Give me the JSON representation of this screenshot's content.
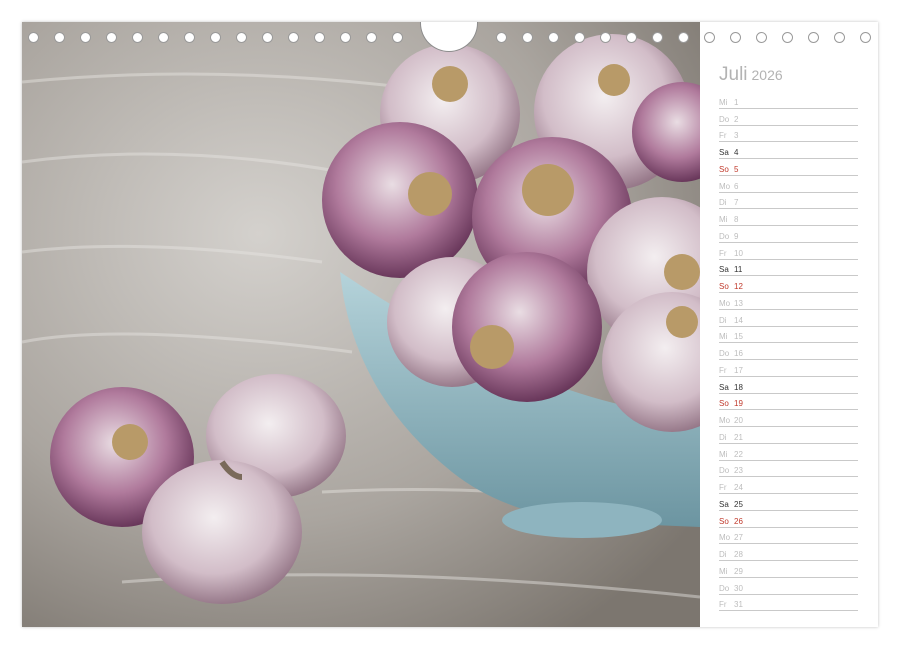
{
  "calendar": {
    "month": "Juli",
    "year": "2026",
    "days": [
      {
        "wd": "Mi",
        "d": "1",
        "type": "weekday"
      },
      {
        "wd": "Do",
        "d": "2",
        "type": "weekday"
      },
      {
        "wd": "Fr",
        "d": "3",
        "type": "weekday"
      },
      {
        "wd": "Sa",
        "d": "4",
        "type": "sat"
      },
      {
        "wd": "So",
        "d": "5",
        "type": "sun"
      },
      {
        "wd": "Mo",
        "d": "6",
        "type": "weekday"
      },
      {
        "wd": "Di",
        "d": "7",
        "type": "weekday"
      },
      {
        "wd": "Mi",
        "d": "8",
        "type": "weekday"
      },
      {
        "wd": "Do",
        "d": "9",
        "type": "weekday"
      },
      {
        "wd": "Fr",
        "d": "10",
        "type": "weekday"
      },
      {
        "wd": "Sa",
        "d": "11",
        "type": "sat"
      },
      {
        "wd": "So",
        "d": "12",
        "type": "sun"
      },
      {
        "wd": "Mo",
        "d": "13",
        "type": "weekday"
      },
      {
        "wd": "Di",
        "d": "14",
        "type": "weekday"
      },
      {
        "wd": "Mi",
        "d": "15",
        "type": "weekday"
      },
      {
        "wd": "Do",
        "d": "16",
        "type": "weekday"
      },
      {
        "wd": "Fr",
        "d": "17",
        "type": "weekday"
      },
      {
        "wd": "Sa",
        "d": "18",
        "type": "sat"
      },
      {
        "wd": "So",
        "d": "19",
        "type": "sun"
      },
      {
        "wd": "Mo",
        "d": "20",
        "type": "weekday"
      },
      {
        "wd": "Di",
        "d": "21",
        "type": "weekday"
      },
      {
        "wd": "Mi",
        "d": "22",
        "type": "weekday"
      },
      {
        "wd": "Do",
        "d": "23",
        "type": "weekday"
      },
      {
        "wd": "Fr",
        "d": "24",
        "type": "weekday"
      },
      {
        "wd": "Sa",
        "d": "25",
        "type": "sat"
      },
      {
        "wd": "So",
        "d": "26",
        "type": "sun"
      },
      {
        "wd": "Mo",
        "d": "27",
        "type": "weekday"
      },
      {
        "wd": "Di",
        "d": "28",
        "type": "weekday"
      },
      {
        "wd": "Mi",
        "d": "29",
        "type": "weekday"
      },
      {
        "wd": "Do",
        "d": "30",
        "type": "weekday"
      },
      {
        "wd": "Fr",
        "d": "31",
        "type": "weekday"
      }
    ]
  },
  "colors": {
    "table": "#a9a49e",
    "bowl": "#9ec3cd",
    "garlic_purple": "#7c3f6c",
    "garlic_light": "#e4d8de",
    "sunday": "#c0392b"
  },
  "photo": {
    "icon": "garlic-bowl-photo"
  }
}
